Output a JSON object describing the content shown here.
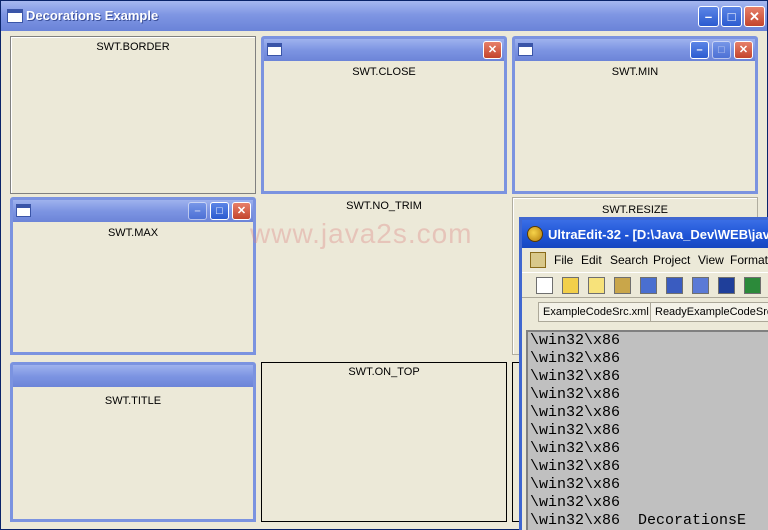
{
  "window": {
    "title": "Decorations Example",
    "minimize_glyph": "–",
    "maximize_glyph": "□",
    "close_glyph": "✕"
  },
  "shells": {
    "border": "SWT.BORDER",
    "close": "SWT.CLOSE",
    "min": "SWT.MIN",
    "max": "SWT.MAX",
    "no_trim": "SWT.NO_TRIM",
    "resize": "SWT.RESIZE",
    "title": "SWT.TITLE",
    "on_top": "SWT.ON_TOP"
  },
  "watermark": "www.java2s.com",
  "ultraedit": {
    "title": "UltraEdit-32 - [D:\\Java_Dev\\WEB\\jav",
    "menu": [
      "File",
      "Edit",
      "Search",
      "Project",
      "View",
      "Format"
    ],
    "tabs": [
      "ExampleCodeSrc.xml",
      "ReadyExampleCodeSrc"
    ],
    "lines": [
      "\\win32\\x86",
      "\\win32\\x86",
      "\\win32\\x86",
      "\\win32\\x86",
      "\\win32\\x86",
      "\\win32\\x86",
      "\\win32\\x86",
      "\\win32\\x86",
      "\\win32\\x86",
      "\\win32\\x86",
      "\\win32\\x86  DecorationsE"
    ]
  },
  "colors": {
    "title_blue": "#7f96e3",
    "ue_title_blue": "#1f55d6",
    "close_red": "#c3442c",
    "face": "#ece9d8"
  }
}
